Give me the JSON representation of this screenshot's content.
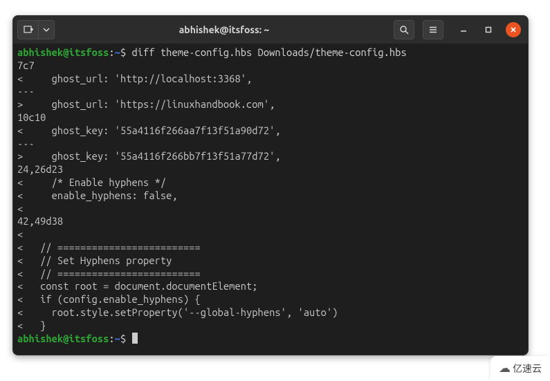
{
  "titlebar": {
    "title": "abhishek@itsfoss: ~",
    "new_tab_icon": "new-tab",
    "dropdown_icon": "chevron-down",
    "search_icon": "search",
    "menu_icon": "hamburger",
    "minimize_icon": "minimize",
    "maximize_icon": "maximize",
    "close_icon": "close"
  },
  "prompt": {
    "user_host": "abhishek@itsfoss",
    "sep1": ":",
    "path": "~",
    "sep2": "$ "
  },
  "command": "diff theme-config.hbs Downloads/theme-config.hbs",
  "output_lines": [
    "7c7",
    "<     ghost_url: 'http://localhost:3368',",
    "---",
    ">     ghost_url: 'https://linuxhandbook.com',",
    "10c10",
    "<     ghost_key: '55a4116f266aa7f13f51a90d72',",
    "---",
    ">     ghost_key: '55a4116f266bb7f13f51a77d72',",
    "24,26d23",
    "<     /* Enable hyphens */",
    "<     enable_hyphens: false,",
    "<",
    "42,49d38",
    "<",
    "<   // =========================",
    "<   // Set Hyphens property",
    "<   // =========================",
    "<   const root = document.documentElement;",
    "<   if (config.enable_hyphens) {",
    "<     root.style.setProperty('--global-hyphens', 'auto')",
    "<   }"
  ],
  "watermark": {
    "text": "亿速云"
  }
}
